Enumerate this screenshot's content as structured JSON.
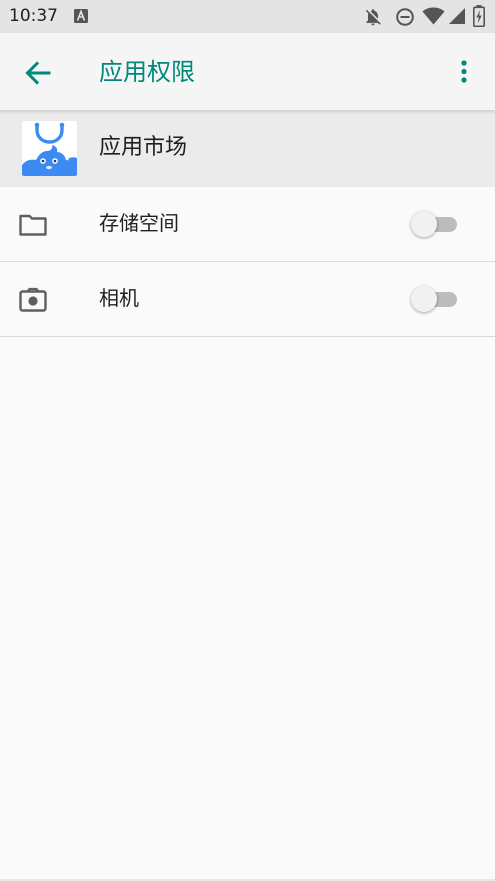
{
  "status_bar": {
    "time": "10:37",
    "icons": [
      "notification-a-icon",
      "notifications-off-icon",
      "do-not-disturb-icon",
      "wifi-icon",
      "cellular-icon",
      "battery-icon"
    ]
  },
  "app_bar": {
    "title": "应用权限",
    "back_icon": "arrow-back-icon",
    "overflow_icon": "more-vert-icon"
  },
  "app": {
    "name": "应用市场",
    "icon": "app-market-icon"
  },
  "permissions": [
    {
      "label": "存储空间",
      "icon": "folder-icon",
      "enabled": false
    },
    {
      "label": "相机",
      "icon": "camera-icon",
      "enabled": false
    }
  ],
  "colors": {
    "accent": "#00897b",
    "status_bar": "#e4e4e4",
    "app_bar": "#f5f5f5",
    "app_header": "#ebebeb",
    "background": "#fafafa",
    "icon_blue": "#3d8bf2"
  }
}
